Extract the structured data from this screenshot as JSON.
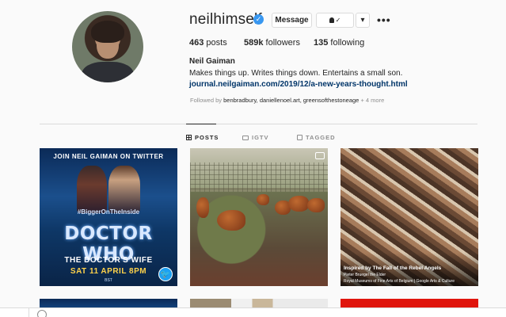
{
  "profile": {
    "username": "neilhimself",
    "verified_mark": "✓",
    "message_label": "Message",
    "following_label": "✓",
    "dropdown_label": "▾",
    "more_label": "•••",
    "stats": {
      "posts_count": "463",
      "posts_label": "posts",
      "followers_count": "589k",
      "followers_label": "followers",
      "following_count": "135",
      "following_label": "following"
    },
    "full_name": "Neil Gaiman",
    "bio": "Makes things up. Writes things down. Entertains a small son.",
    "link": "journal.neilgaiman.com/2019/12/a-new-years-thought.html",
    "followed_by_prefix": "Followed by ",
    "followed_by_names": "benbradbury, daniellenoel.art, greensofthestoneage",
    "followed_by_more": " + 4 more"
  },
  "tabs": [
    {
      "label": "POSTS",
      "icon": "grid-icon",
      "active": true
    },
    {
      "label": "IGTV",
      "icon": "tv-icon",
      "active": false
    },
    {
      "label": "TAGGED",
      "icon": "tag-icon",
      "active": false
    }
  ],
  "posts": [
    {
      "top_text": "JOIN NEIL GAIMAN ON TWITTER",
      "hashtag": "#BiggerOnTheInside",
      "logo": "DOCTOR WHO",
      "subtitle": "THE DOCTOR'S WIFE",
      "date": "SAT 11 APRIL 8PM",
      "bst": "BST",
      "badge_icon": "twitter-icon"
    },
    {
      "badge_icon": "video-icon"
    },
    {
      "title": "Inspired by The Fall of the Rebel Angels",
      "artist": "Pieter Bruegel the Elder",
      "source": "Royal Museums of Fine Arts of Belgium | Google Arts & Culture"
    }
  ],
  "colors": {
    "accent": "#3897f0",
    "link": "#003569",
    "muted": "#8e8e8e",
    "border": "#dbdbdb"
  }
}
